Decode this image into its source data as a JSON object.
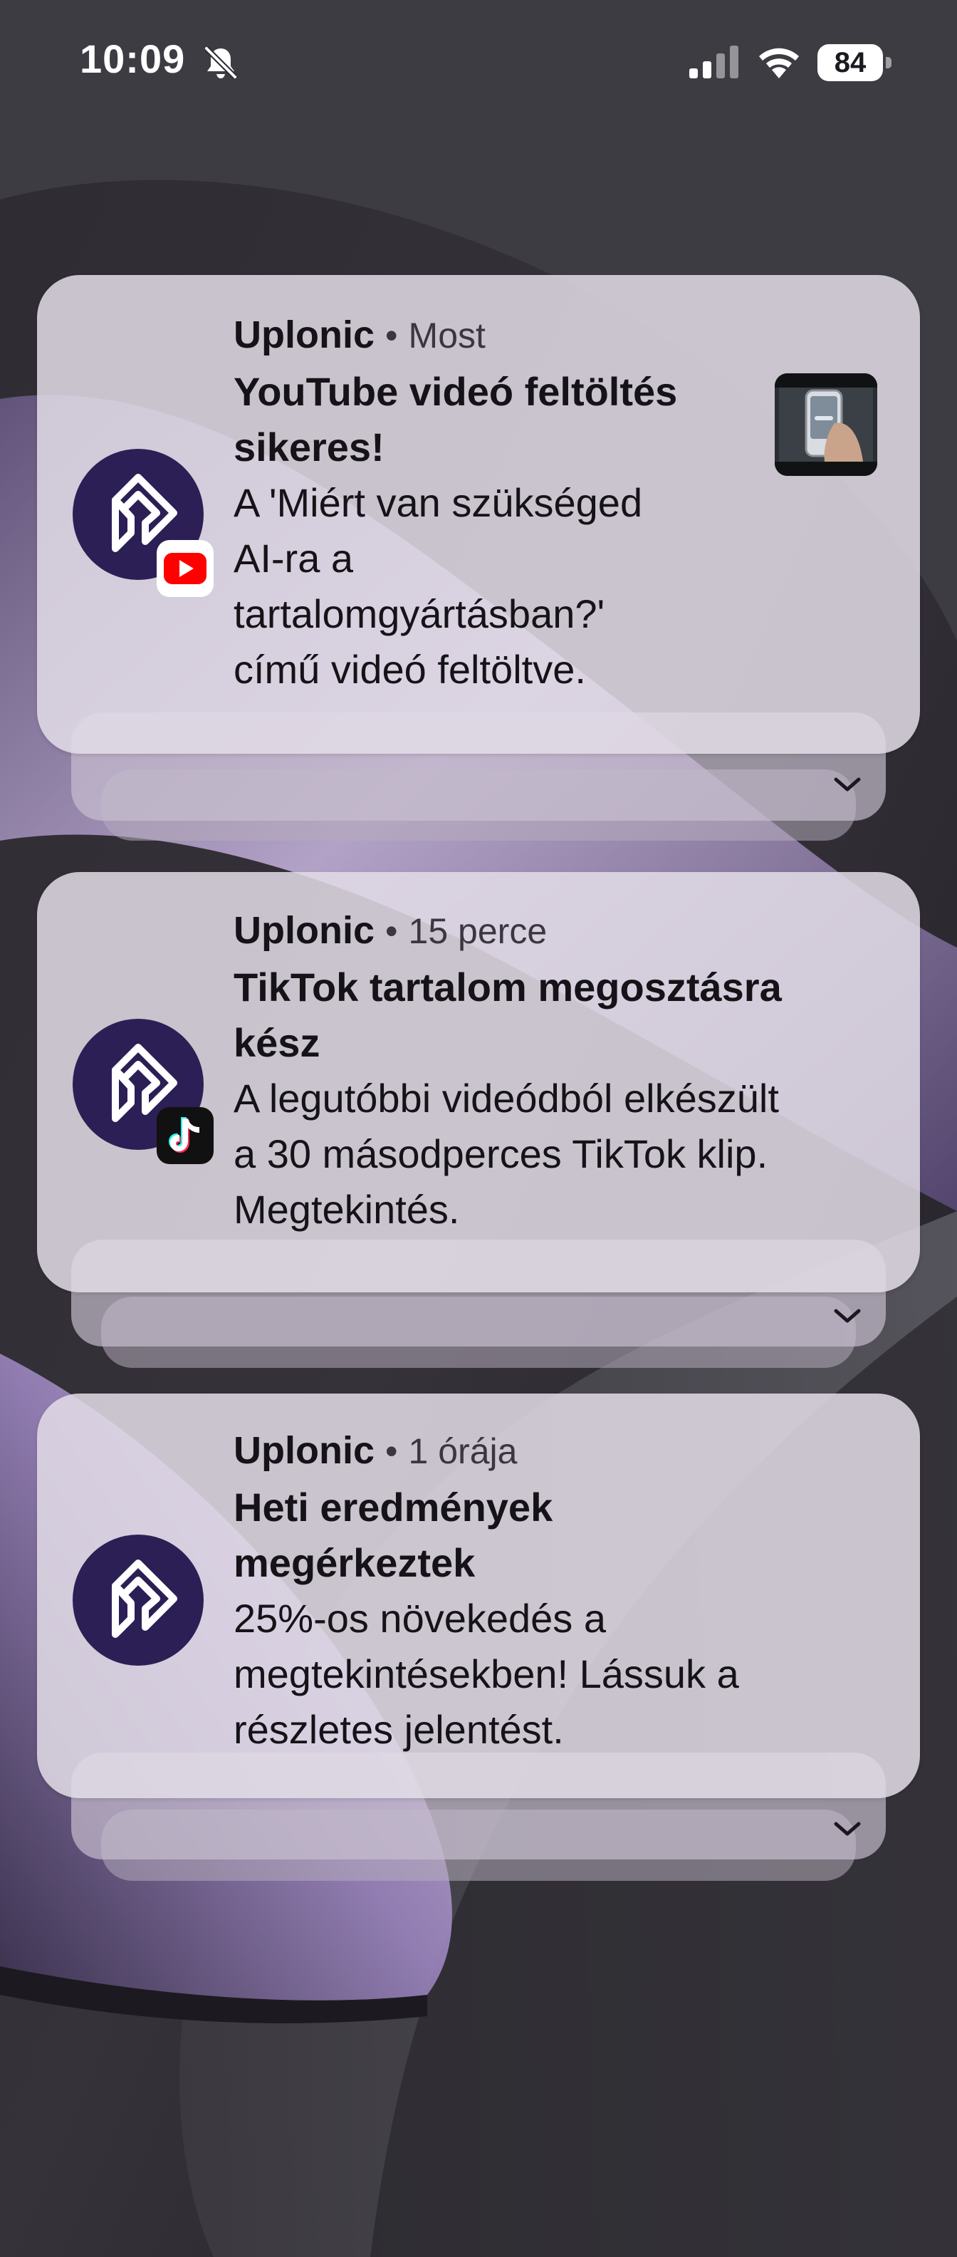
{
  "status_bar": {
    "time": "10:09",
    "battery_level": "84",
    "icons": [
      "bell-slash-icon",
      "cellular-signal-icon",
      "wifi-icon",
      "battery-icon"
    ]
  },
  "notifications": [
    {
      "app": "Uplonic",
      "separator": "•",
      "time": "Most",
      "title": "YouTube videó feltöltés sikeres!",
      "title_lines": [
        "YouTube videó feltöltés",
        "sikeres!"
      ],
      "body_lines": [
        "A 'Miért van szükséged",
        "AI-ra a",
        "tartalomgyártásban?'",
        "című videó feltöltve."
      ],
      "badge_icon": "youtube-icon",
      "has_thumbnail": true
    },
    {
      "app": "Uplonic",
      "separator": "•",
      "time": "15 perce",
      "title_lines": [
        "TikTok tartalom megosztásra",
        "kész"
      ],
      "body_lines": [
        "A legutóbbi videódból elkészült",
        "a 30 másodperces TikTok klip.",
        "Megtekintés."
      ],
      "badge_icon": "tiktok-icon",
      "has_thumbnail": false
    },
    {
      "app": "Uplonic",
      "separator": "•",
      "time": "1 órája",
      "title_lines": [
        "Heti eredmények",
        "megérkeztek"
      ],
      "body_lines": [
        "25%-os növekedés a",
        "megtekintésekben! Lássuk a",
        "részletes jelentést."
      ],
      "badge_icon": "",
      "has_thumbnail": false
    }
  ],
  "colors": {
    "card_background": "#e2dce6",
    "app_icon_background": "#2c1f55",
    "youtube_red": "#ff0000",
    "wallpaper_lavender": "#c9b6e0"
  }
}
